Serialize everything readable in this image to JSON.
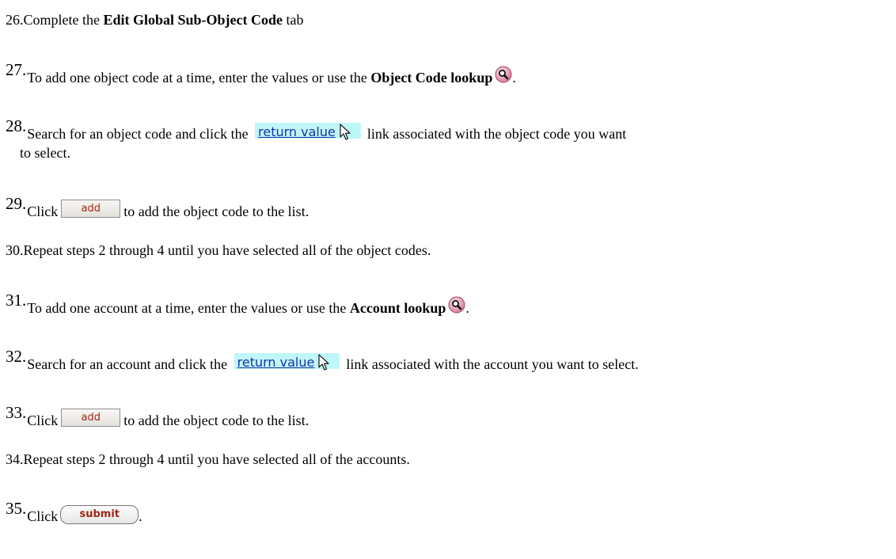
{
  "steps": [
    {
      "num": "26.",
      "pre": "Complete the ",
      "bold": "Edit Global Sub-Object Code",
      "post": " tab"
    },
    {
      "num": "27.",
      "pre": "To add one object code at a time, enter the values or use the ",
      "bold": "Object Code lookup",
      "icon": "magnifier-lookup-icon",
      "post": "."
    },
    {
      "num": "28.",
      "pre": "Search for an object code and click the ",
      "link": "return value",
      "post": "link associated with the object code you want",
      "cont": "to select."
    },
    {
      "num": "29.",
      "pre": "Click",
      "button": "add",
      "post": "to add the object code to the list."
    },
    {
      "num": "30.",
      "text": "Repeat steps 2 through 4 until you have selected all of the object codes."
    },
    {
      "num": "31.",
      "pre": "To add one account at a time, enter the values or use the ",
      "bold": "Account lookup",
      "icon": "magnifier-lookup-icon",
      "post": "."
    },
    {
      "num": "32.",
      "pre": "Search for an account and click the ",
      "link": "return value",
      "post": "link associated with the account you want to select."
    },
    {
      "num": "33.",
      "pre": "Click",
      "button": "add",
      "post": "to add the object code to the list."
    },
    {
      "num": "34.",
      "text": "Repeat steps 2 through 4 until you have selected all of the accounts."
    },
    {
      "num": "35.",
      "pre": "Click",
      "button": "submit",
      "post": "."
    }
  ],
  "colors": {
    "link_text": "#1a33a8",
    "link_highlight": "#bff6f8",
    "button_text": "#a02814",
    "lookup_icon_fill": "#e9a0b4"
  }
}
